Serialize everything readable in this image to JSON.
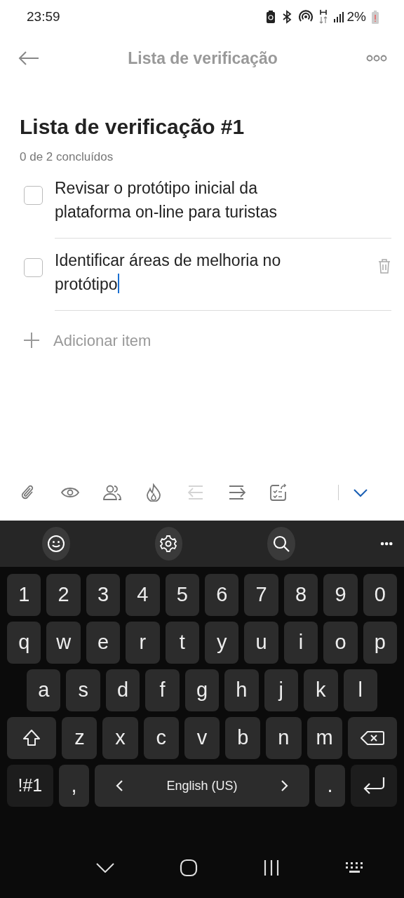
{
  "status_bar": {
    "time": "23:59",
    "battery": "2%"
  },
  "header": {
    "title": "Lista de verificação"
  },
  "checklist": {
    "title": "Lista de verificação #1",
    "progress": "0 de 2 concluídos",
    "items": [
      {
        "text": "Revisar o protótipo inicial da plataforma on-line para turistas",
        "checked": false,
        "editing": false
      },
      {
        "text": "Identificar áreas de melhoria no protótipo",
        "checked": false,
        "editing": true
      }
    ],
    "add_item": "Adicionar item"
  },
  "toolbar": [
    {
      "kind": "attach",
      "disabled": false
    },
    {
      "kind": "eye",
      "disabled": false
    },
    {
      "kind": "people",
      "disabled": false
    },
    {
      "kind": "flame",
      "disabled": false
    },
    {
      "kind": "outdent",
      "disabled": true
    },
    {
      "kind": "indent",
      "disabled": false
    },
    {
      "kind": "checklist",
      "disabled": false
    },
    {
      "kind": "collapse",
      "disabled": false
    }
  ],
  "keyboard": {
    "rows": [
      [
        {
          "kind": "char",
          "label": "1"
        },
        {
          "kind": "char",
          "label": "2"
        },
        {
          "kind": "char",
          "label": "3"
        },
        {
          "kind": "char",
          "label": "4"
        },
        {
          "kind": "char",
          "label": "5"
        },
        {
          "kind": "char",
          "label": "6"
        },
        {
          "kind": "char",
          "label": "7"
        },
        {
          "kind": "char",
          "label": "8"
        },
        {
          "kind": "char",
          "label": "9"
        },
        {
          "kind": "char",
          "label": "0"
        }
      ],
      [
        {
          "kind": "char",
          "label": "q"
        },
        {
          "kind": "char",
          "label": "w"
        },
        {
          "kind": "char",
          "label": "e"
        },
        {
          "kind": "char",
          "label": "r"
        },
        {
          "kind": "char",
          "label": "t"
        },
        {
          "kind": "char",
          "label": "y"
        },
        {
          "kind": "char",
          "label": "u"
        },
        {
          "kind": "char",
          "label": "i"
        },
        {
          "kind": "char",
          "label": "o"
        },
        {
          "kind": "char",
          "label": "p"
        }
      ],
      [
        {
          "kind": "char",
          "label": "a"
        },
        {
          "kind": "char",
          "label": "s"
        },
        {
          "kind": "char",
          "label": "d"
        },
        {
          "kind": "char",
          "label": "f"
        },
        {
          "kind": "char",
          "label": "g"
        },
        {
          "kind": "char",
          "label": "h"
        },
        {
          "kind": "char",
          "label": "j"
        },
        {
          "kind": "char",
          "label": "k"
        },
        {
          "kind": "char",
          "label": "l"
        }
      ],
      [
        {
          "kind": "shift"
        },
        {
          "kind": "char",
          "label": "z"
        },
        {
          "kind": "char",
          "label": "x"
        },
        {
          "kind": "char",
          "label": "c"
        },
        {
          "kind": "char",
          "label": "v"
        },
        {
          "kind": "char",
          "label": "b"
        },
        {
          "kind": "char",
          "label": "n"
        },
        {
          "kind": "char",
          "label": "m"
        },
        {
          "kind": "backspace"
        }
      ],
      [
        {
          "kind": "enter"
        }
      ]
    ],
    "bottom_row": {
      "symbols": "!#1",
      "comma": ",",
      "space": "English (US)",
      "period": "."
    }
  }
}
